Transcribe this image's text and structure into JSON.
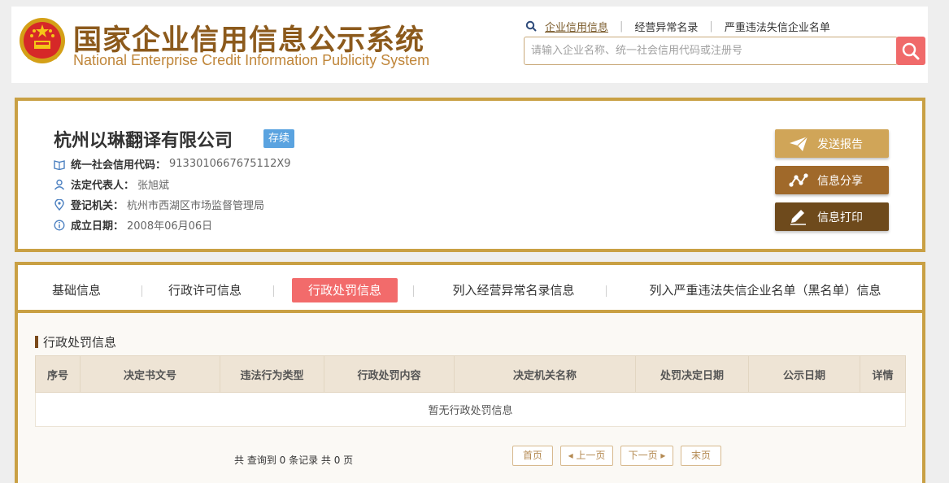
{
  "header": {
    "title_cn": "国家企业信用信息公示系统",
    "title_en": "National Enterprise Credit Information Publicity System",
    "nav": [
      {
        "label": "企业信用信息"
      },
      {
        "label": "经营异常名录"
      },
      {
        "label": "严重违法失信企业名单"
      }
    ],
    "search_placeholder": "请输入企业名称、统一社会信用代码或注册号"
  },
  "company": {
    "name": "杭州以琳翻译有限公司",
    "status": "存续",
    "fields": [
      {
        "label": "统一社会信用代码：",
        "value": "9133010667675112X9"
      },
      {
        "label": "法定代表人：",
        "value": "张旭斌"
      },
      {
        "label": "登记机关：",
        "value": "杭州市西湖区市场监督管理局"
      },
      {
        "label": "成立日期：",
        "value": "2008年06月06日"
      }
    ]
  },
  "actions": {
    "report": "发送报告",
    "share": "信息分享",
    "print": "信息打印"
  },
  "tabs": [
    {
      "label": "基础信息"
    },
    {
      "label": "行政许可信息"
    },
    {
      "label": "行政处罚信息"
    },
    {
      "label": "列入经营异常名录信息"
    },
    {
      "label": "列入严重违法失信企业名单（黑名单）信息"
    }
  ],
  "section": {
    "title": "行政处罚信息",
    "columns": [
      "序号",
      "决定书文号",
      "违法行为类型",
      "行政处罚内容",
      "决定机关名称",
      "处罚决定日期",
      "公示日期",
      "详情"
    ],
    "empty_text": "暂无行政处罚信息",
    "total_text": "共 查询到 0 条记录 共 0 页"
  },
  "pagination": {
    "first": "首页",
    "prev": "上一页",
    "next": "下一页",
    "last": "末页"
  },
  "colors": {
    "brand_gold": "#c9a044",
    "title_brown": "#8c5a1c",
    "accent_red": "#f26b6b",
    "badge_blue": "#5aa3e0"
  }
}
